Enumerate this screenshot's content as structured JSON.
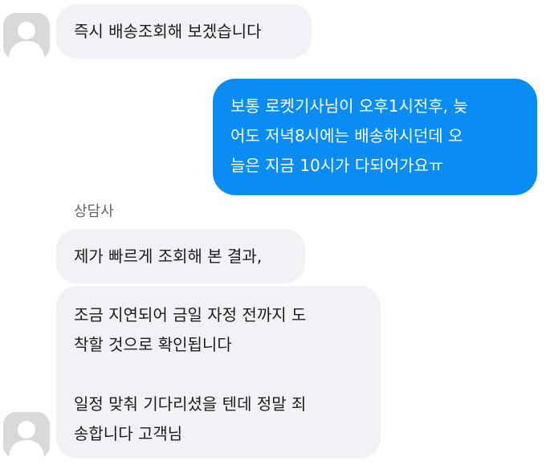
{
  "messages": [
    {
      "side": "received",
      "text": "즉시 배송조회해 보겠습니다"
    },
    {
      "side": "sent",
      "text": "보통 로켓기사님이 오후1시전후, 늦\n어도 저녁8시에는 배송하시던데 오\n늘은 지금 10시가 다되어가요ㅠ"
    },
    {
      "side": "received",
      "sender": "상담사",
      "text": "제가 빠르게 조회해 본 결과,"
    },
    {
      "side": "received",
      "text": "조금 지연되어 금일 자정 전까지 도\n착할 것으로 확인됩니다\n\n일정 맞춰 기다리셨을 텐데 정말 죄\n송합니다 고객님"
    }
  ],
  "colors": {
    "sent_bubble": "#0a8cf5",
    "received_bubble": "#f1f2f5",
    "avatar_bg": "#d9d9d9"
  },
  "icons": {
    "avatar": "default-profile-icon"
  }
}
